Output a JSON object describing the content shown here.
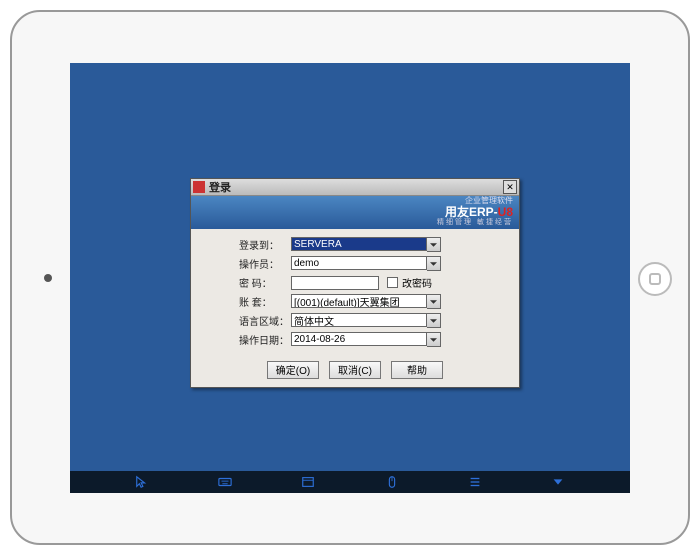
{
  "dialog": {
    "title": "登录",
    "brand": {
      "subtitle": "企业管理软件",
      "name_prefix": "用友",
      "name_erp": "ERP-",
      "name_u8": "U8",
      "tagline": "精细管理 敏捷经营"
    },
    "labels": {
      "login_to": "登录到：",
      "operator": "操作员：",
      "password": "密 码：",
      "change_password": "改密码",
      "account_set": "账 套：",
      "language": "语言区域：",
      "operation_date": "操作日期："
    },
    "values": {
      "login_to": "SERVERA",
      "operator": "demo",
      "password": "",
      "account_set": "[(001)(default)]天翼集团",
      "language": "简体中文",
      "operation_date": "2014-08-26"
    },
    "buttons": {
      "ok": "确定(O)",
      "cancel": "取消(C)",
      "help": "帮助"
    }
  }
}
